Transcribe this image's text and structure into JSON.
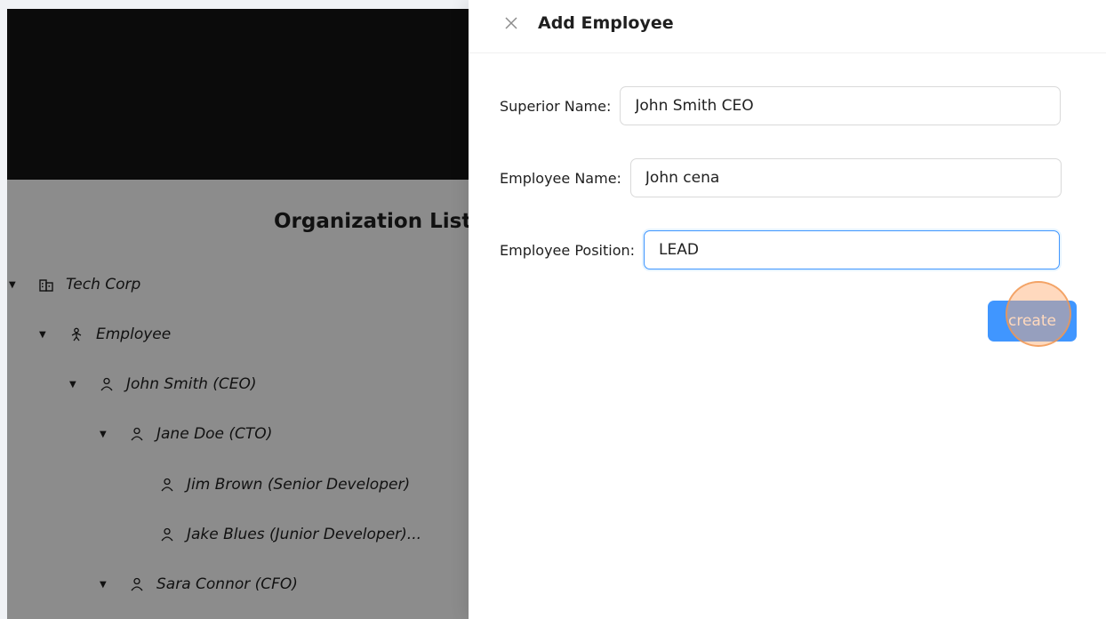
{
  "page": {
    "title": "Organization List"
  },
  "tree": [
    {
      "label": "Tech Corp",
      "icon": "building-icon",
      "expanded": true,
      "level": 0
    },
    {
      "label": "Employee",
      "icon": "org-icon",
      "expanded": true,
      "level": 1
    },
    {
      "label": "John Smith (CEO)",
      "icon": "user-icon",
      "expanded": true,
      "level": 2
    },
    {
      "label": "Jane Doe (CTO)",
      "icon": "user-icon",
      "expanded": true,
      "level": 3
    },
    {
      "label": "Jim Brown (Senior Developer)",
      "icon": "user-icon",
      "expanded": false,
      "level": 4
    },
    {
      "label": "Jake Blues (Junior Developer)...",
      "icon": "user-icon",
      "expanded": false,
      "level": 4
    },
    {
      "label": "Sara Connor (CFO)",
      "icon": "user-icon",
      "expanded": true,
      "level": 3
    }
  ],
  "drawer": {
    "title": "Add Employee",
    "superior_label": "Superior Name",
    "superior_value": "John Smith CEO",
    "employee_label": "Employee Name",
    "employee_value": "John cena",
    "position_label": "Employee Position",
    "position_value": "LEAD",
    "create_label": "create"
  },
  "colors": {
    "primary": "#4096ff",
    "header": "#141414"
  }
}
